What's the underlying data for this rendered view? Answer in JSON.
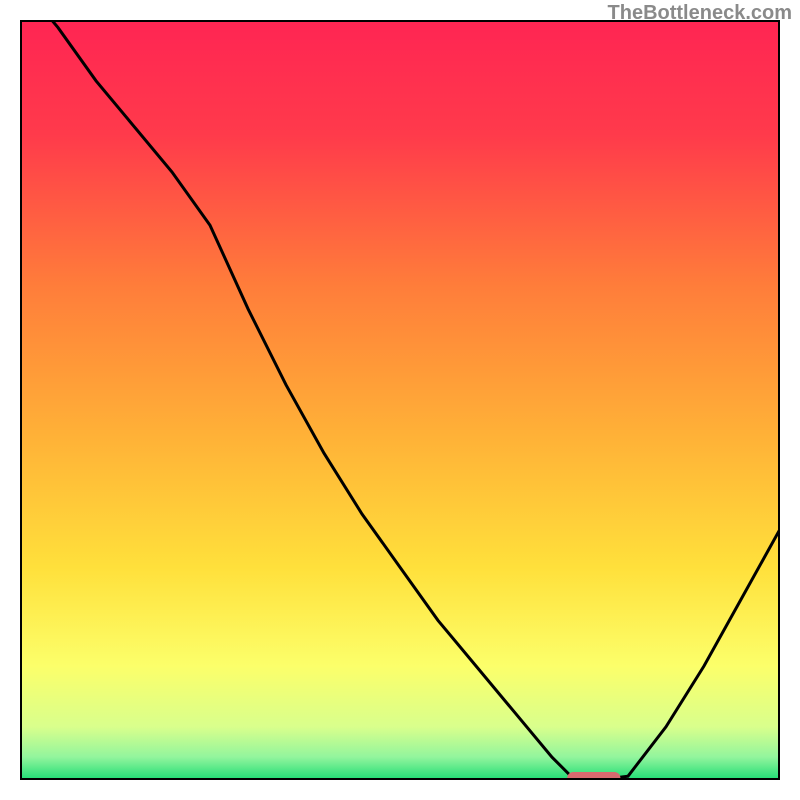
{
  "attribution": "TheBottleneck.com",
  "chart_data": {
    "type": "line",
    "title": "",
    "xlabel": "",
    "ylabel": "",
    "xlim": [
      0,
      100
    ],
    "ylim": [
      0,
      100
    ],
    "x": [
      0,
      5,
      10,
      15,
      20,
      25,
      30,
      35,
      40,
      45,
      50,
      55,
      60,
      65,
      70,
      73,
      76,
      80,
      85,
      90,
      95,
      100
    ],
    "values": [
      105,
      99,
      92,
      86,
      80,
      73,
      62,
      52,
      43,
      35,
      28,
      21,
      15,
      9,
      3,
      0,
      0,
      0.5,
      7,
      15,
      24,
      33
    ],
    "flat_segment": {
      "x_start": 72,
      "x_end": 79,
      "y": 0,
      "color": "#d86a6f"
    },
    "background_gradient": {
      "stops": [
        {
          "offset": 0.0,
          "color": "#ff2553"
        },
        {
          "offset": 0.15,
          "color": "#ff3a4b"
        },
        {
          "offset": 0.35,
          "color": "#ff7d3a"
        },
        {
          "offset": 0.55,
          "color": "#ffb237"
        },
        {
          "offset": 0.72,
          "color": "#ffe03b"
        },
        {
          "offset": 0.85,
          "color": "#fcff6a"
        },
        {
          "offset": 0.93,
          "color": "#d9ff8c"
        },
        {
          "offset": 0.97,
          "color": "#92f59d"
        },
        {
          "offset": 1.0,
          "color": "#1edc74"
        }
      ]
    },
    "axes_visible": false,
    "border": {
      "width": 4,
      "color": "#000000"
    }
  }
}
